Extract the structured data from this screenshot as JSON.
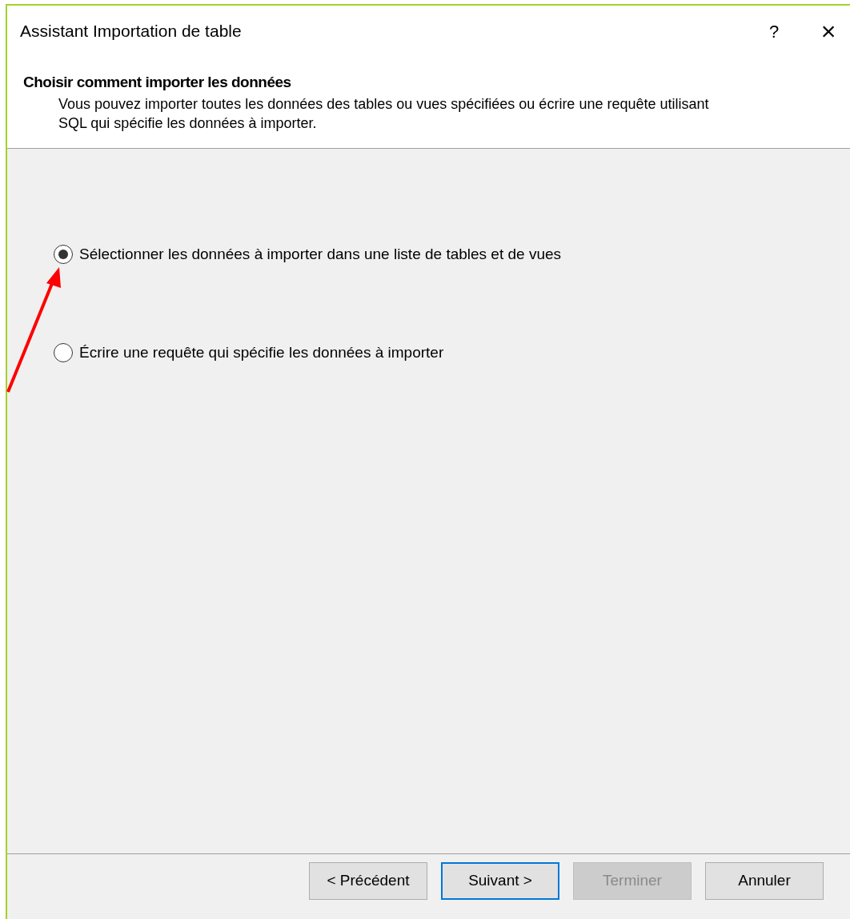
{
  "window": {
    "title": "Assistant Importation de table",
    "help": "?",
    "close": "×"
  },
  "header": {
    "title": "Choisir comment importer les données",
    "description": "Vous pouvez importer toutes les données des tables ou vues spécifiées ou écrire une requête utilisant SQL qui spécifie les données à importer."
  },
  "options": [
    {
      "label": "Sélectionner les données à importer dans une liste de tables et de vues",
      "selected": true
    },
    {
      "label": "Écrire une requête qui spécifie les données à importer",
      "selected": false
    }
  ],
  "buttons": [
    {
      "label": "< Précédent",
      "disabled": false,
      "focused": false
    },
    {
      "label": "Suivant >",
      "disabled": false,
      "focused": true
    },
    {
      "label": "Terminer",
      "disabled": true,
      "focused": false
    },
    {
      "label": "Annuler",
      "disabled": false,
      "focused": false
    }
  ]
}
